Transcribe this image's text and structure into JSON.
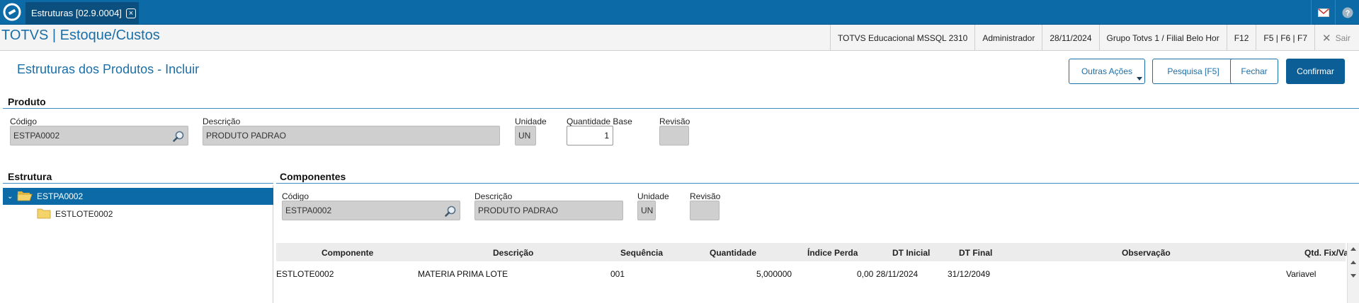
{
  "topbar": {
    "tab_label": "Estruturas [02.9.0004]",
    "tab_close": "⊗",
    "icons": [
      "totvs-logo-icon",
      "mail-icon",
      "help-icon"
    ]
  },
  "header": {
    "app_title": "TOTVS | Estoque/Custos",
    "environment": "TOTVS Educacional MSSQL 2310",
    "user": "Administrador",
    "date": "28/11/2024",
    "branch": "Grupo Totvs 1 / Filial Belo Hor",
    "f12": "F12",
    "fkeys": "F5 | F6 | F7",
    "sair": "Sair"
  },
  "page": {
    "title": "Estruturas dos Produtos - Incluir",
    "buttons": {
      "outras_acoes": "Outras Ações",
      "pesquisa": "Pesquisa [F5]",
      "fechar": "Fechar",
      "confirmar": "Confirmar"
    }
  },
  "produto": {
    "section_title": "Produto",
    "codigo_label": "Código",
    "codigo_value": "ESTPA0002",
    "descricao_label": "Descrição",
    "descricao_value": "PRODUTO PADRAO",
    "unidade_label": "Unidade",
    "unidade_value": "UN",
    "quantidade_label": "Quantidade Base",
    "quantidade_value": "1",
    "revisao_label": "Revisão",
    "revisao_value": ""
  },
  "estrutura": {
    "section_title": "Estrutura",
    "items": [
      {
        "label": "ESTPA0002"
      },
      {
        "label": "ESTLOTE0002"
      }
    ]
  },
  "componentes": {
    "section_title": "Componentes",
    "codigo_label": "Código",
    "codigo_value": "ESTPA0002",
    "descricao_label": "Descrição",
    "descricao_value": "PRODUTO PADRAO",
    "unidade_label": "Unidade",
    "unidade_value": "UN",
    "revisao_label": "Revisão",
    "revisao_value": ""
  },
  "grid": {
    "columns": [
      "Componente",
      "Descrição",
      "Sequência",
      "Quantidade",
      "Índice Perda",
      "DT Inicial",
      "DT Final",
      "Observação",
      "Qtd. Fix/Va"
    ],
    "rows": [
      [
        "ESTLOTE0002",
        "MATERIA PRIMA LOTE",
        "001",
        "5,000000",
        "0,00",
        "28/11/2024",
        "31/12/2049",
        "",
        "Variavel"
      ]
    ]
  },
  "colors": {
    "brand_blue": "#0c6aa6",
    "title_blue": "#1b6fa8",
    "primary_button": "#0c5f96",
    "selected_row": "#0c6aa6",
    "field_gray": "#cfcfcf"
  }
}
